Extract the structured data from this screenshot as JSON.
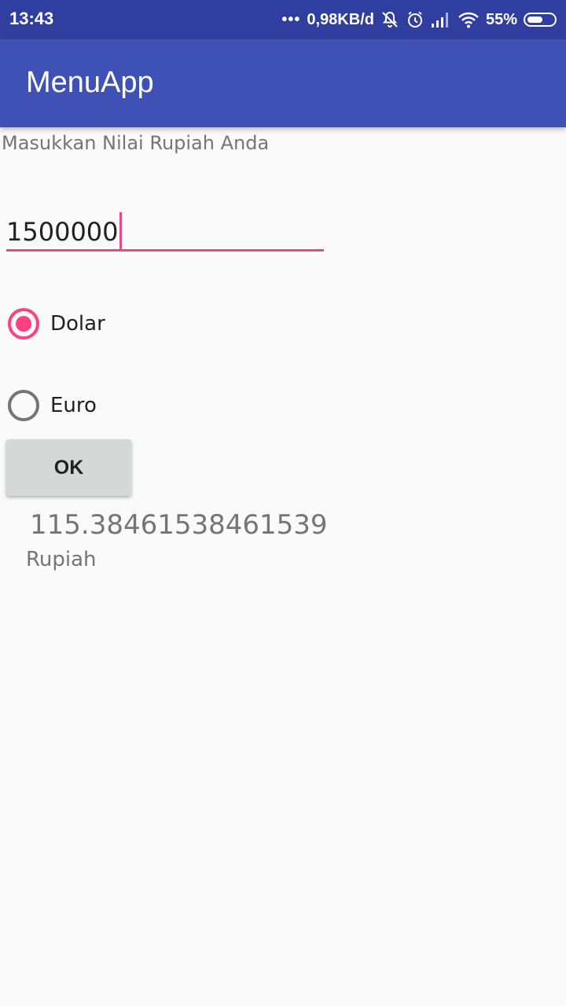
{
  "status_bar": {
    "time": "13:43",
    "network_speed": "0,98KB/d",
    "battery_percent": "55%",
    "icons": [
      "more-dots-icon",
      "notifications-off-icon",
      "alarm-icon",
      "signal-icon",
      "wifi-icon",
      "battery-icon"
    ]
  },
  "app_bar": {
    "title": "MenuApp",
    "color": "#3f51b5"
  },
  "form": {
    "prompt": "Masukkan Nilai Rupiah Anda",
    "amount_value": "1500000",
    "options": [
      {
        "label": "Dolar",
        "checked": true
      },
      {
        "label": "Euro",
        "checked": false
      }
    ],
    "ok_label": "OK"
  },
  "result": {
    "value": "115.38461538461539",
    "unit": "Rupiah"
  },
  "colors": {
    "accent": "#ff4081",
    "status_bar": "#303f9f"
  }
}
